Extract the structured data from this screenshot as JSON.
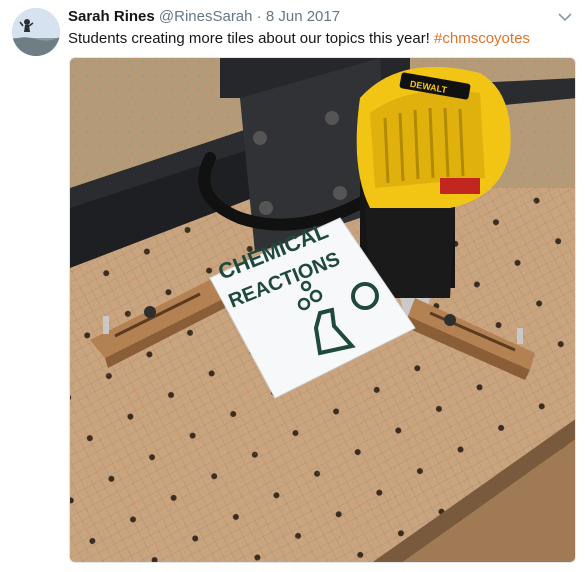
{
  "tweet": {
    "display_name": "Sarah Rines",
    "handle": "@RinesSarah",
    "separator": "·",
    "date": "8 Jun 2017",
    "text": "Students creating more tiles about our topics this year!",
    "hashtag": "#chmscoyotes",
    "colors": {
      "hashtag": "#e0712c",
      "name": "#14171a",
      "meta": "#657786"
    }
  },
  "media": {
    "tile_line1": "CHEMICAL",
    "tile_line2": "REACTIONS",
    "router_label": "DEWALT"
  },
  "icons": {
    "avatar": "profile-photo",
    "caret": "chevron-down-icon"
  }
}
